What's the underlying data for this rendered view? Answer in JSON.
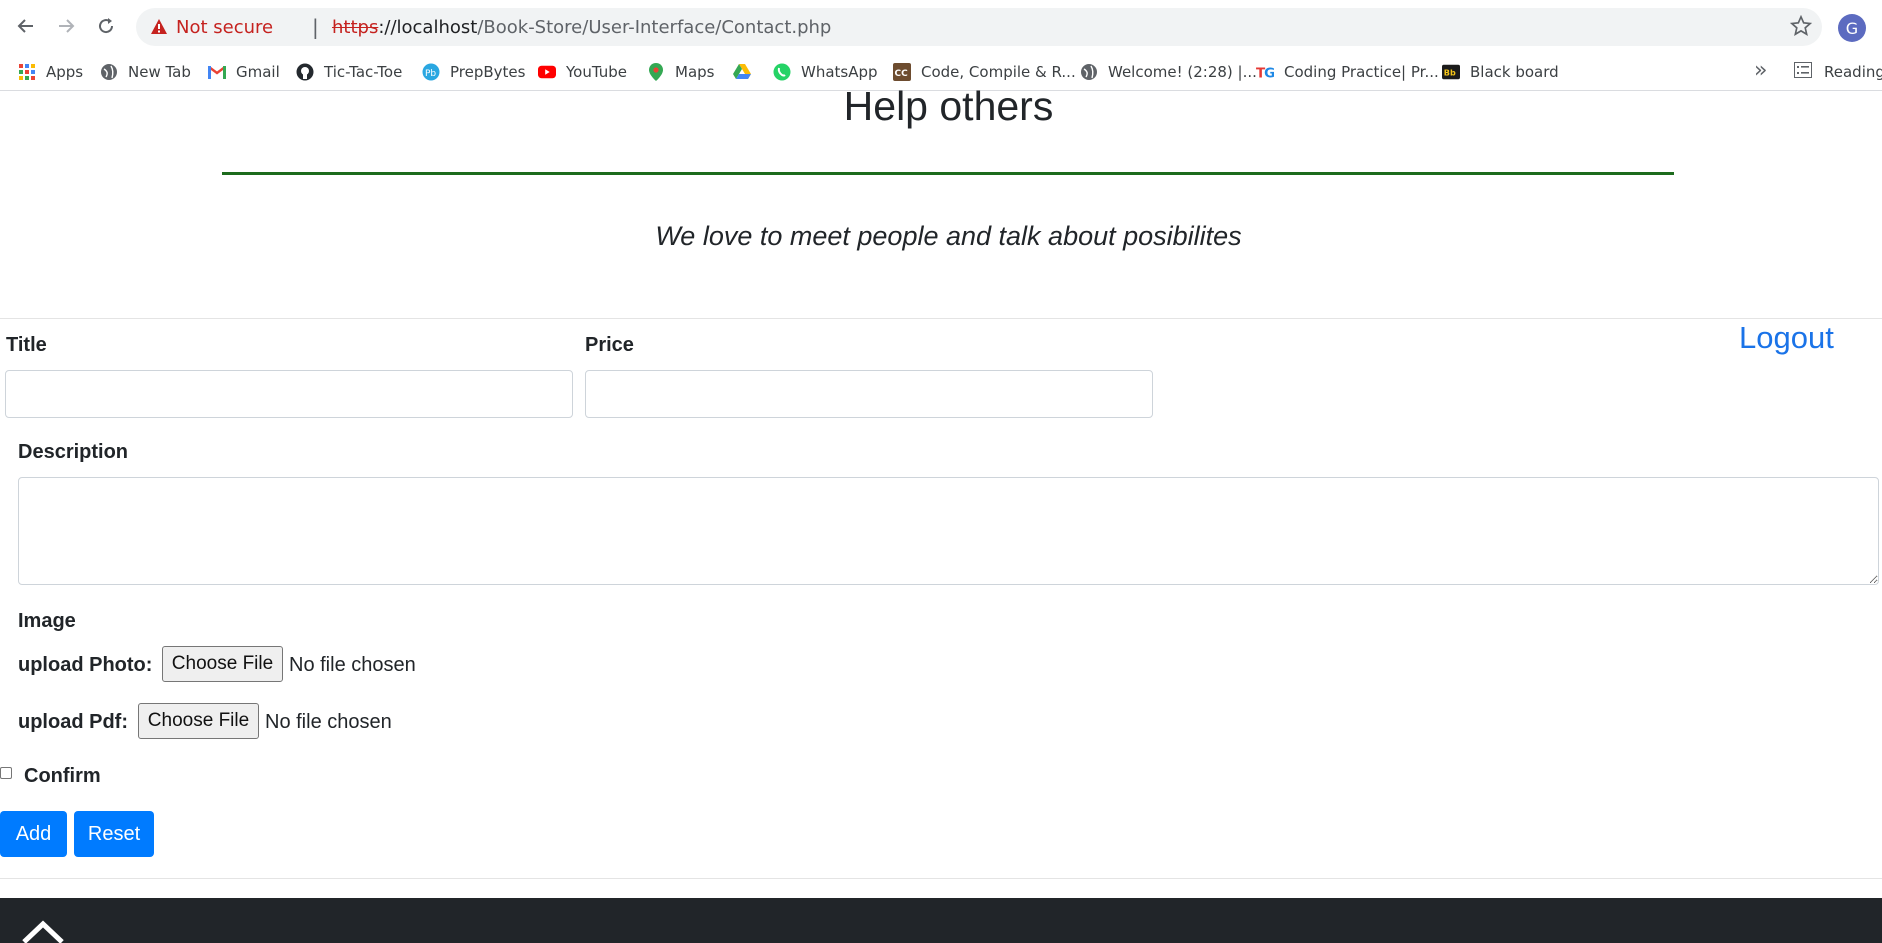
{
  "browser": {
    "security_label": "Not secure",
    "separator": "|",
    "url_scheme": "https",
    "url_host": "://localhost",
    "url_path": "/Book-Store/User-Interface/Contact.php",
    "avatar_letter": "G",
    "more_chevron": "»",
    "reading_list_label": "Reading"
  },
  "bookmarks": [
    {
      "label": "Apps",
      "icon": "apps-grid-icon"
    },
    {
      "label": "New Tab",
      "icon": "globe-icon"
    },
    {
      "label": "Gmail",
      "icon": "gmail-icon"
    },
    {
      "label": "Tic-Tac-Toe",
      "icon": "github-icon"
    },
    {
      "label": "PrepBytes",
      "icon": "prepbytes-icon"
    },
    {
      "label": "YouTube",
      "icon": "youtube-icon"
    },
    {
      "label": "Maps",
      "icon": "maps-pin-icon"
    },
    {
      "label": "",
      "icon": "google-drive-icon"
    },
    {
      "label": "WhatsApp",
      "icon": "whatsapp-icon"
    },
    {
      "label": "Code, Compile & R...",
      "icon": "cc-icon"
    },
    {
      "label": "Welcome! (2:28) |...",
      "icon": "globe-icon"
    },
    {
      "label": "Coding Practice| Pr...",
      "icon": "tg-icon"
    },
    {
      "label": "Black board",
      "icon": "blackboard-icon"
    }
  ],
  "page": {
    "title": "Help others",
    "tagline": "We love to meet people and talk about posibilites",
    "logout_label": "Logout"
  },
  "form": {
    "title_label": "Title",
    "title_value": "",
    "price_label": "Price",
    "price_value": "",
    "description_label": "Description",
    "description_value": "",
    "image_label": "Image",
    "upload_photo_label": "upload Photo:",
    "upload_pdf_label": "upload Pdf:",
    "choose_file_label": "Choose File",
    "no_file_text": "No file chosen",
    "confirm_label": "Confirm",
    "add_label": "Add",
    "reset_label": "Reset"
  },
  "colors": {
    "primary_button": "#007bff",
    "logout_link": "#1a73e8",
    "divider_green": "#1d6b1d",
    "footer_bg": "#212529"
  }
}
